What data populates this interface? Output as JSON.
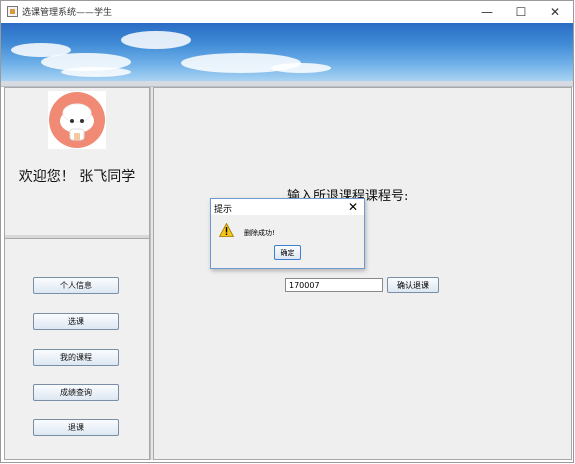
{
  "window": {
    "title": "选课管理系统——学生",
    "minimize_glyph": "—",
    "maximize_glyph": "☐",
    "close_glyph": "✕"
  },
  "sidebar": {
    "welcome": "欢迎您！ 张飞同学",
    "avatar_icon": "cartoon-avatar-icon",
    "items": [
      {
        "label": "个人信息"
      },
      {
        "label": "选课"
      },
      {
        "label": "我的课程"
      },
      {
        "label": "成绩查询"
      },
      {
        "label": "退课"
      }
    ]
  },
  "main": {
    "prompt": "输入所退课程课程号:",
    "course_input_value": "170007",
    "confirm_label": "确认退课"
  },
  "dialog": {
    "title": "提示",
    "close_glyph": "✕",
    "icon": "warning-icon",
    "message": "删除成功!",
    "ok_label": "确定"
  },
  "colors": {
    "banner_top": "#2a6cc4",
    "banner_bottom": "#a9d3f2",
    "avatar_bg": "#f08a74",
    "dialog_border": "#6f9ad1"
  }
}
